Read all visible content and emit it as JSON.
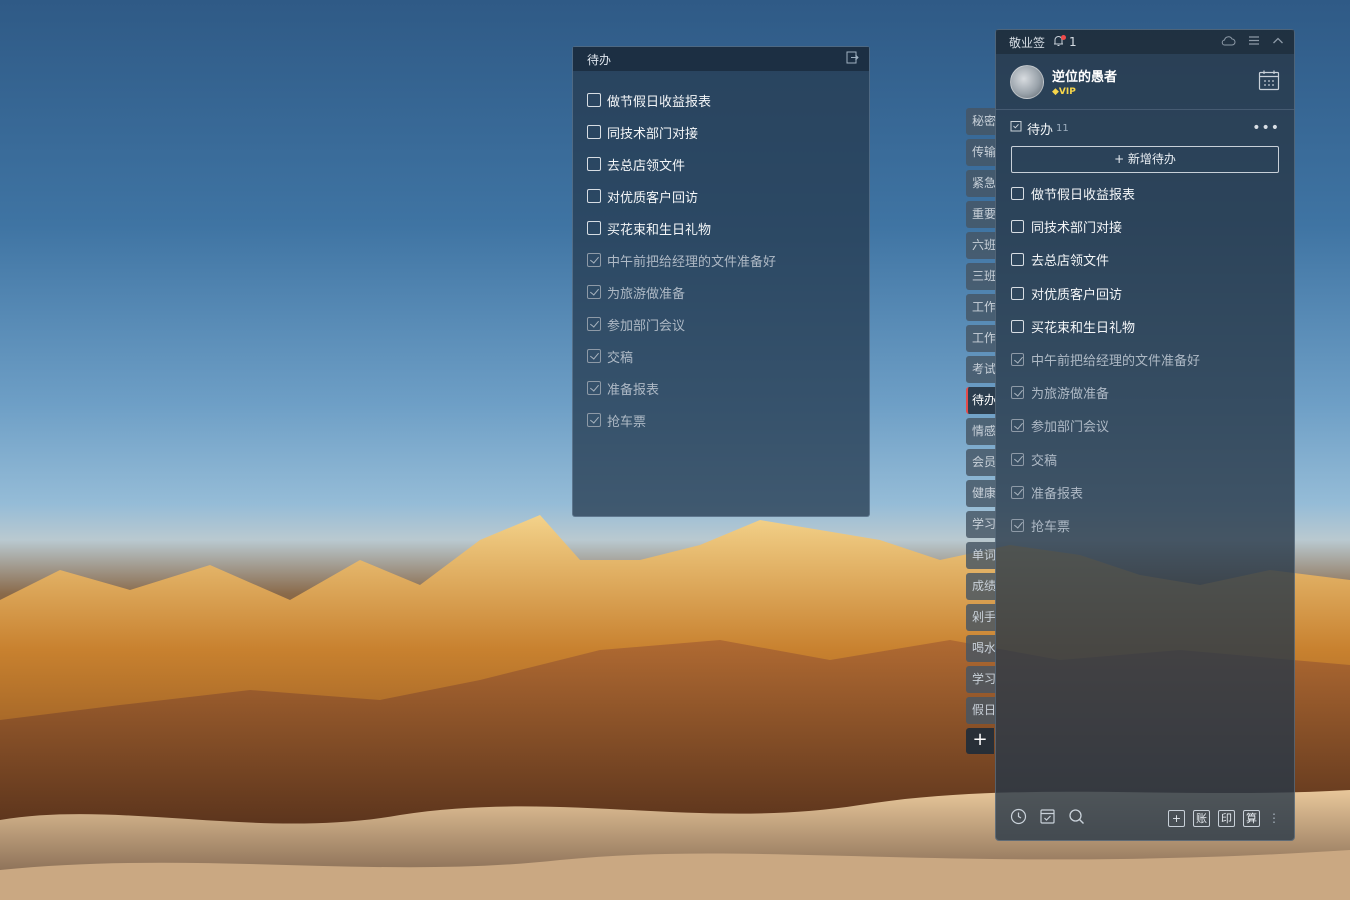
{
  "floating_window": {
    "title": "待办",
    "items": [
      {
        "text": "做节假日收益报表",
        "done": false
      },
      {
        "text": "同技术部门对接",
        "done": false
      },
      {
        "text": "去总店领文件",
        "done": false
      },
      {
        "text": "对优质客户回访",
        "done": false
      },
      {
        "text": "买花束和生日礼物",
        "done": false
      },
      {
        "text": "中午前把给经理的文件准备好",
        "done": true
      },
      {
        "text": "为旅游做准备",
        "done": true
      },
      {
        "text": "参加部门会议",
        "done": true
      },
      {
        "text": "交稿",
        "done": true
      },
      {
        "text": "准备报表",
        "done": true
      },
      {
        "text": "抢车票",
        "done": true
      }
    ]
  },
  "side_tabs": [
    {
      "label": "秘密",
      "active": false
    },
    {
      "label": "传输",
      "active": false
    },
    {
      "label": "紧急",
      "active": false
    },
    {
      "label": "重要",
      "active": false
    },
    {
      "label": "六班",
      "active": false
    },
    {
      "label": "三班",
      "active": false
    },
    {
      "label": "工作",
      "active": false
    },
    {
      "label": "工作",
      "active": false
    },
    {
      "label": "考试",
      "active": false
    },
    {
      "label": "待办",
      "active": true
    },
    {
      "label": "情感",
      "active": false
    },
    {
      "label": "会员",
      "active": false
    },
    {
      "label": "健康",
      "active": false
    },
    {
      "label": "学习",
      "active": false
    },
    {
      "label": "单词",
      "active": false
    },
    {
      "label": "成绩",
      "active": false
    },
    {
      "label": "剁手",
      "active": false
    },
    {
      "label": "喝水",
      "active": false
    },
    {
      "label": "学习",
      "active": false
    },
    {
      "label": "假日",
      "active": false
    }
  ],
  "side_add_label": "+",
  "main_panel": {
    "app_name": "敬业签",
    "notification_count": "1",
    "user": {
      "name": "逆位的愚者",
      "badge": "VIP"
    },
    "section": {
      "title": "待办",
      "count": "11",
      "more": "•••"
    },
    "new_button": "+ 新增待办",
    "items": [
      {
        "text": "做节假日收益报表",
        "done": false
      },
      {
        "text": "同技术部门对接",
        "done": false
      },
      {
        "text": "去总店领文件",
        "done": false
      },
      {
        "text": "对优质客户回访",
        "done": false
      },
      {
        "text": "买花束和生日礼物",
        "done": false
      },
      {
        "text": "中午前把给经理的文件准备好",
        "done": true
      },
      {
        "text": "为旅游做准备",
        "done": true
      },
      {
        "text": "参加部门会议",
        "done": true
      },
      {
        "text": "交稿",
        "done": true
      },
      {
        "text": "准备报表",
        "done": true
      },
      {
        "text": "抢车票",
        "done": true
      }
    ],
    "footer": {
      "left_icons": [
        "clock-icon",
        "checklist-icon",
        "search-icon"
      ],
      "right_buttons": [
        "+",
        "账",
        "印",
        "算"
      ]
    }
  }
}
